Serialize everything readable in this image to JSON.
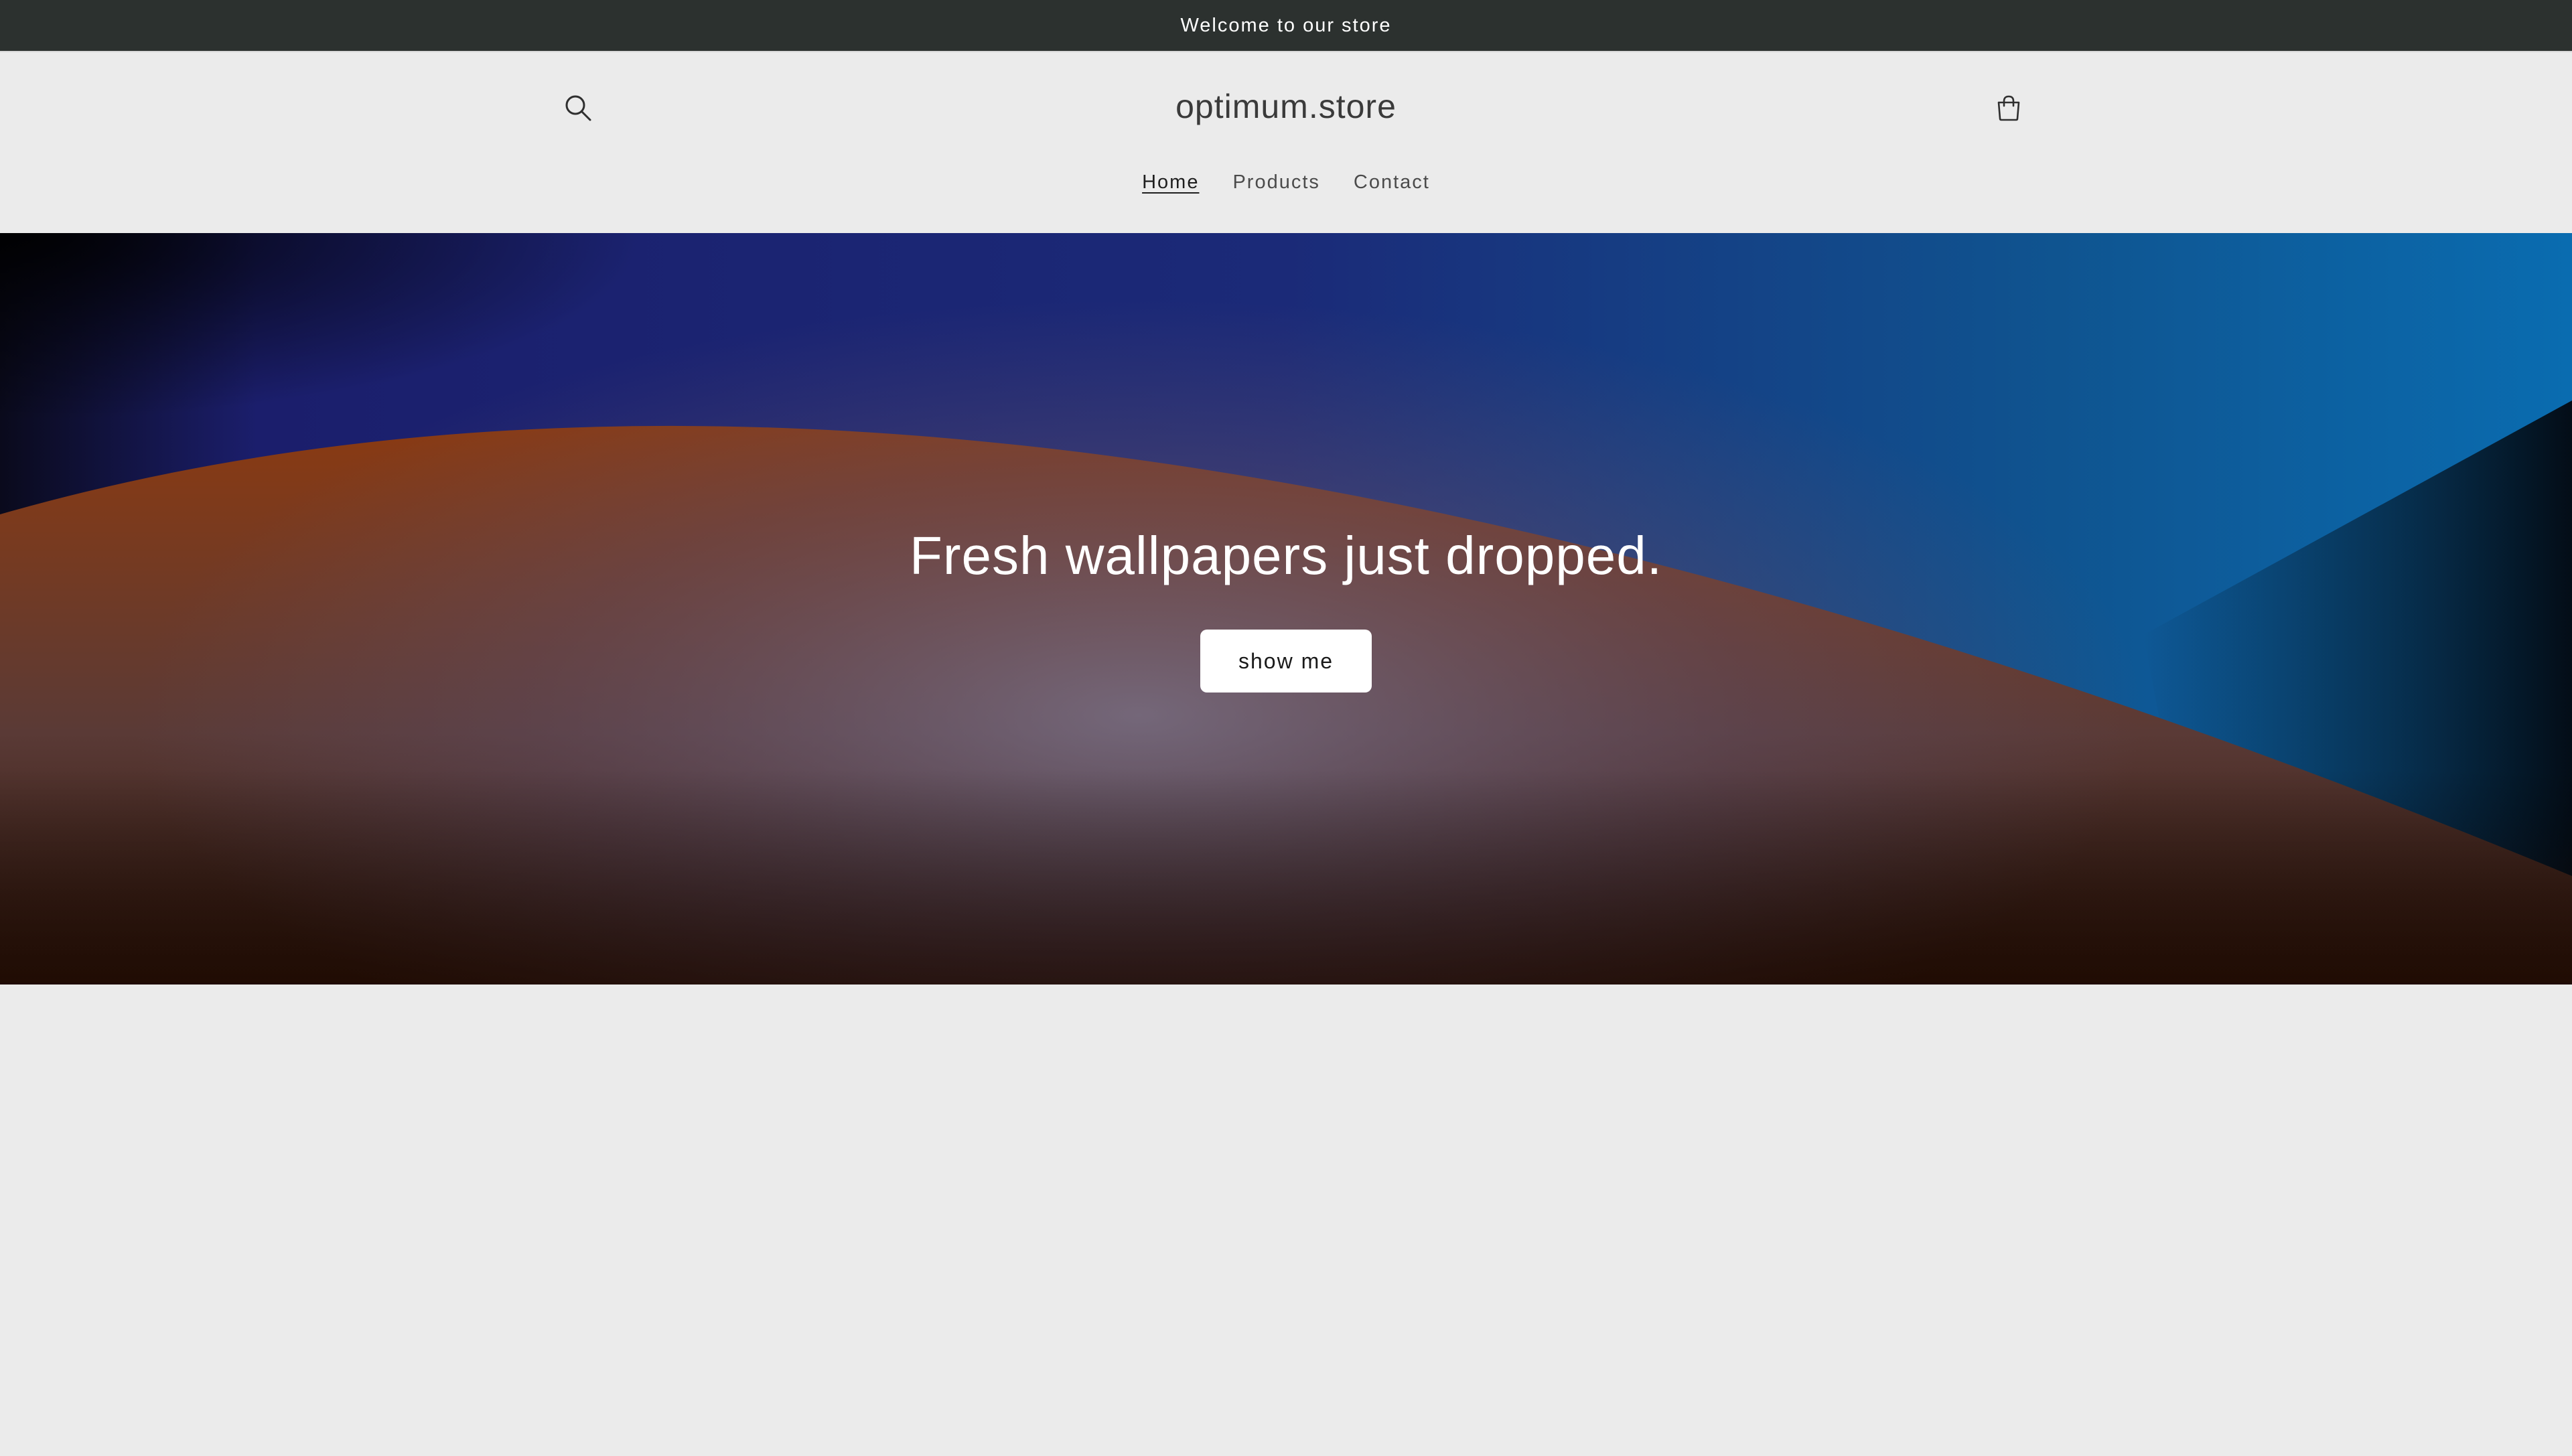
{
  "announcement": {
    "text": "Welcome to our store"
  },
  "header": {
    "logo_text": "optimum.store",
    "search_icon": "search-icon",
    "cart_icon": "shopping-bag-icon",
    "nav": [
      {
        "label": "Home",
        "active": true
      },
      {
        "label": "Products",
        "active": false
      },
      {
        "label": "Contact",
        "active": false
      }
    ]
  },
  "hero": {
    "title": "Fresh wallpapers just dropped.",
    "button_label": "show me"
  },
  "colors": {
    "announcement_bg": "#2c312f",
    "page_bg": "#ebebeb",
    "hero_blue": "#1d1f70",
    "hero_orange": "#7f3914",
    "button_bg": "#ffffff"
  }
}
